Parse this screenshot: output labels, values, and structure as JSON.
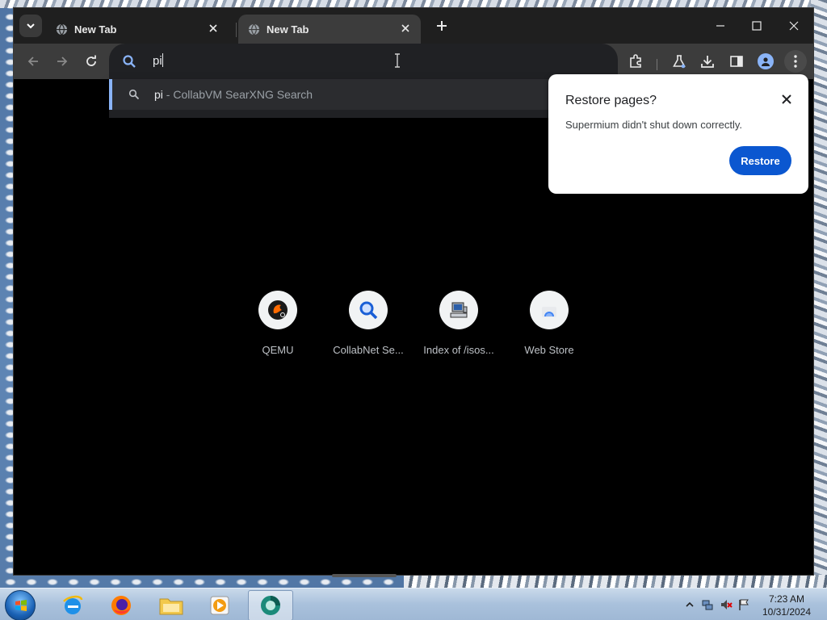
{
  "browser": {
    "tabs": [
      {
        "title": "New Tab",
        "active": false
      },
      {
        "title": "New Tab",
        "active": true
      }
    ],
    "omnibox": {
      "value": "pi"
    },
    "suggestion": {
      "query": "pi",
      "separator": " - ",
      "source": "CollabVM SearXNG Search"
    },
    "shortcuts": [
      {
        "label": "QEMU",
        "icon": "qemu-icon"
      },
      {
        "label": "CollabNet Se...",
        "icon": "magnifier-icon"
      },
      {
        "label": "Index of /isos...",
        "icon": "computer-icon"
      },
      {
        "label": "Web Store",
        "icon": "web-store-icon"
      }
    ],
    "restore_bubble": {
      "title": "Restore pages?",
      "message": "Supermium didn't shut down correctly.",
      "button": "Restore"
    },
    "colors": {
      "accent": "#0b57d0",
      "omnibox_bg": "#202124",
      "toolbar_bg": "#3c3c3c"
    }
  },
  "taskbar": {
    "apps": [
      "internet-explorer-icon",
      "firefox-icon",
      "file-explorer-icon",
      "media-player-icon",
      "supermium-icon"
    ],
    "clock": {
      "time": "7:23 AM",
      "date": "10/31/2024"
    }
  }
}
